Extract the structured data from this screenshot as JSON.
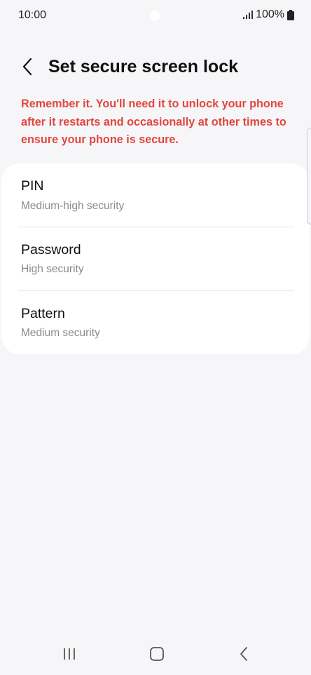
{
  "status_bar": {
    "time": "10:00",
    "battery_text": "100%",
    "icons": [
      "signal-icon",
      "battery-icon"
    ]
  },
  "header": {
    "back_icon": "chevron-left-icon",
    "title": "Set secure screen lock"
  },
  "warning": {
    "text": "Remember it. You'll need it to unlock your phone after it restarts and occasionally at other times to ensure your phone is secure.",
    "color": "#e2463f"
  },
  "options": [
    {
      "title": "PIN",
      "subtitle": "Medium-high security"
    },
    {
      "title": "Password",
      "subtitle": "High security"
    },
    {
      "title": "Pattern",
      "subtitle": "Medium security"
    }
  ],
  "nav_bar": {
    "icons": [
      "recent-apps-icon",
      "home-icon",
      "back-icon"
    ]
  }
}
